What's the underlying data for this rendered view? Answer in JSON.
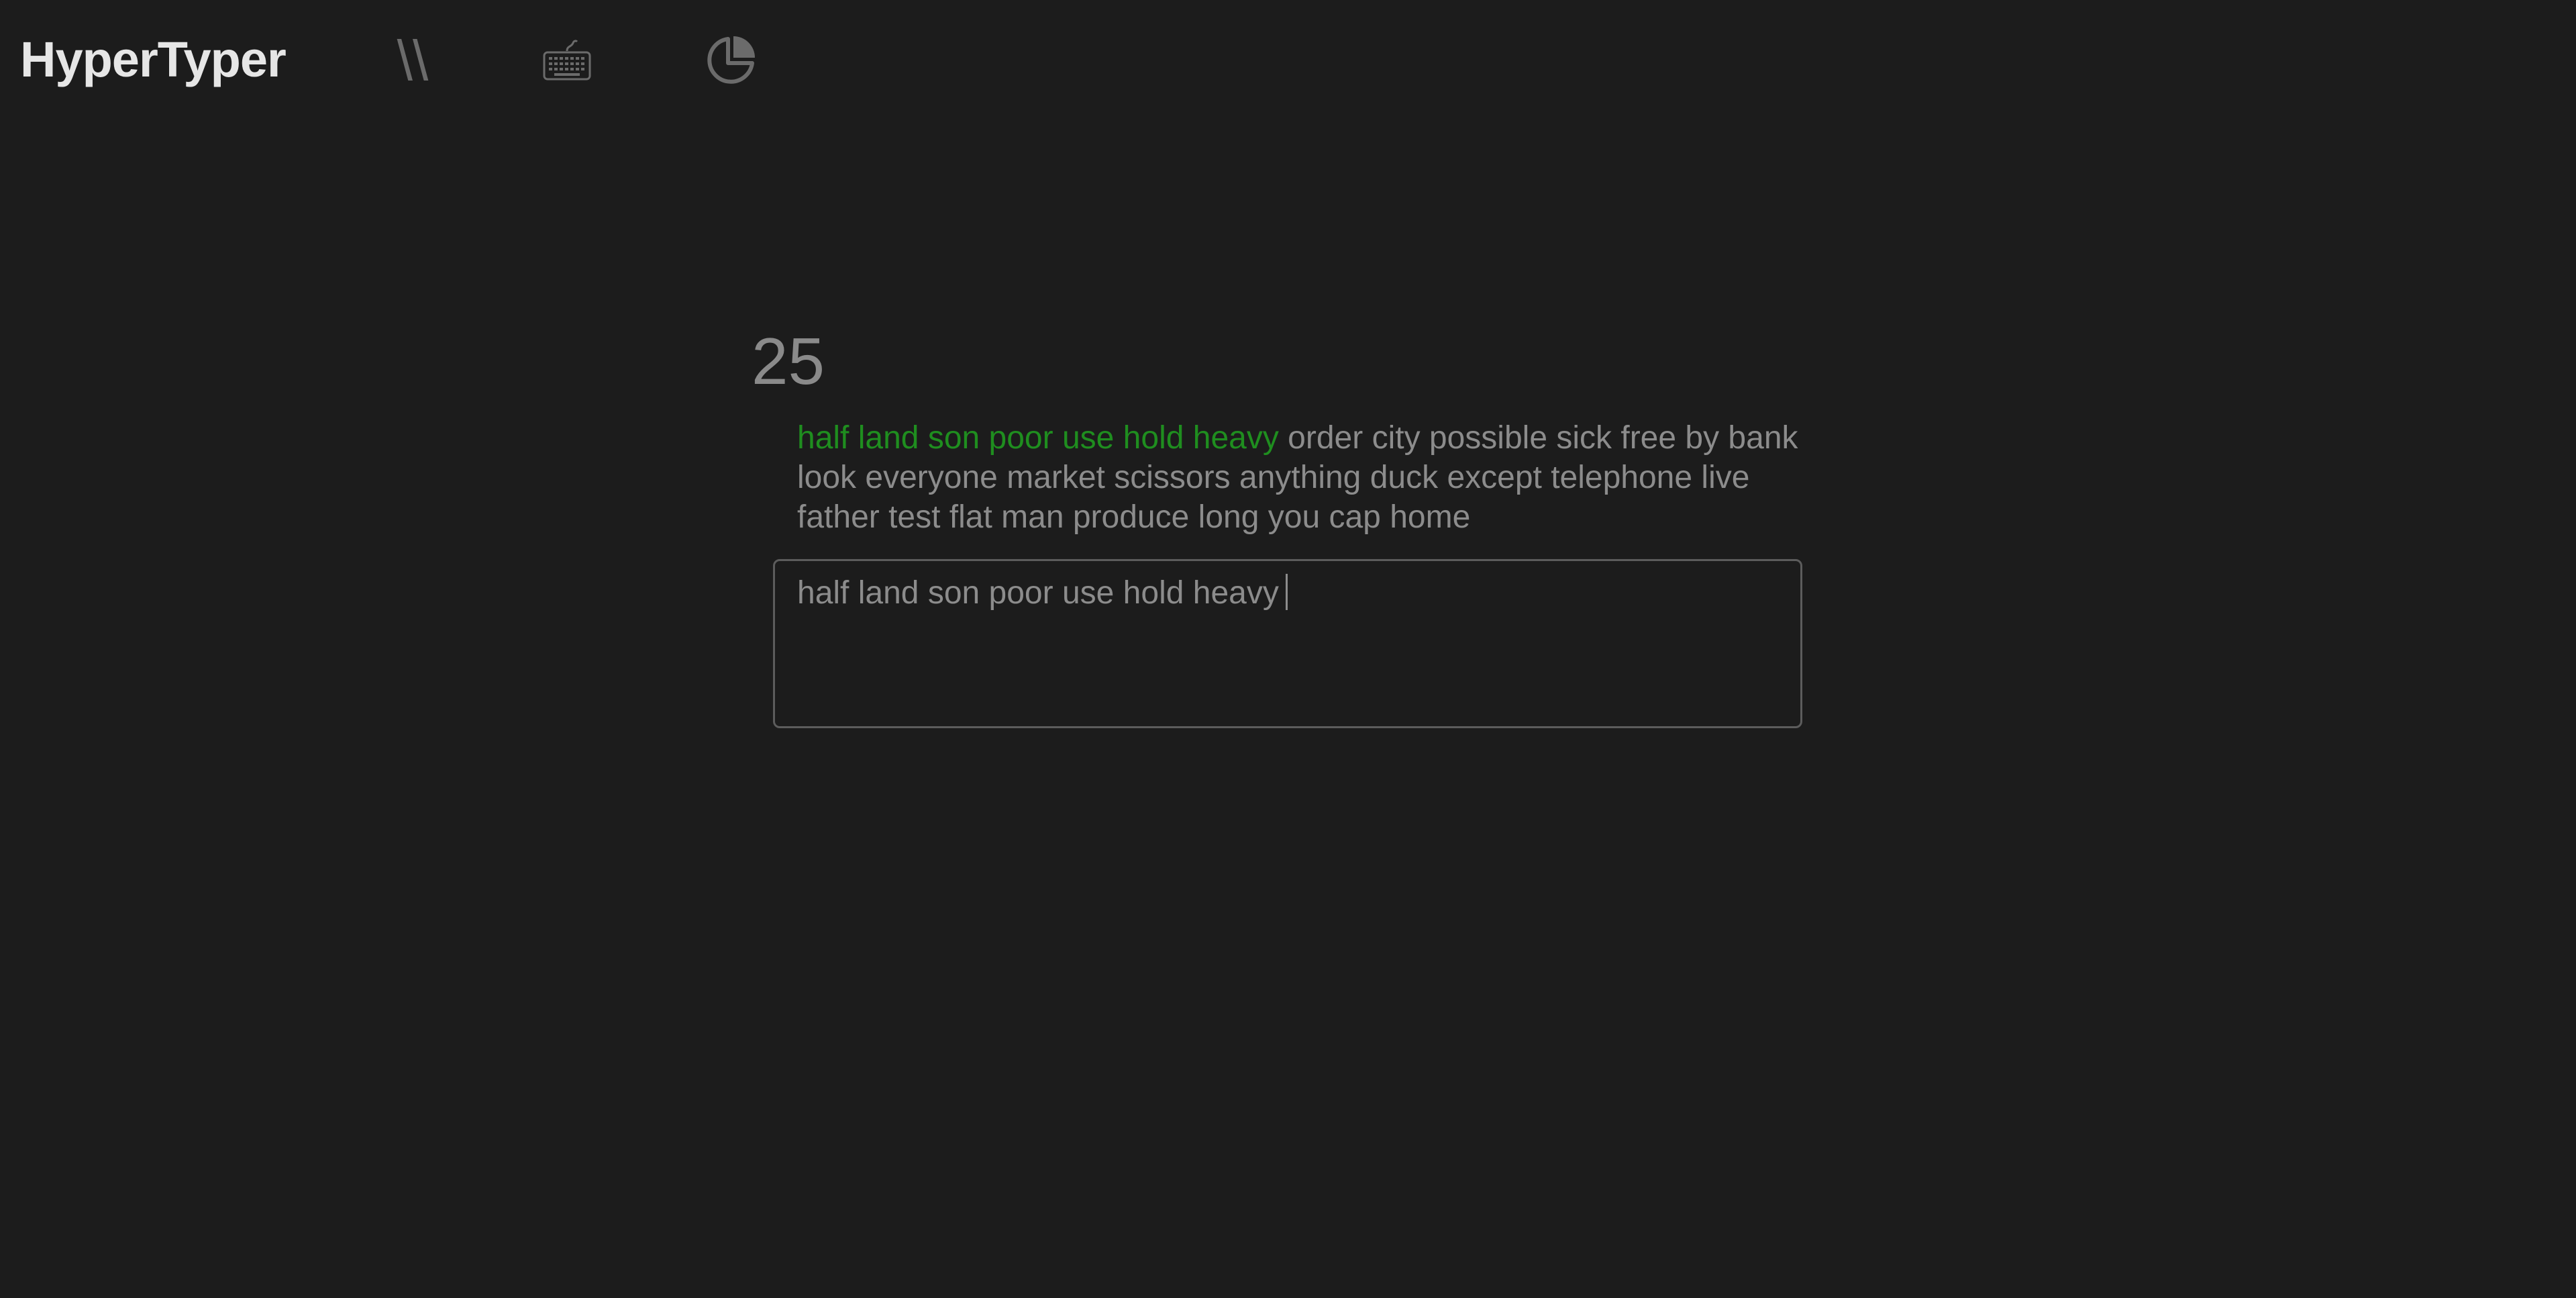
{
  "app": {
    "title": "HyperTyper"
  },
  "nav": {
    "items": [
      {
        "name": "test-mode",
        "icon": "double-slash-icon",
        "label": "\\\\"
      },
      {
        "name": "keyboard",
        "icon": "keyboard-icon"
      },
      {
        "name": "stats",
        "icon": "pie-chart-icon"
      }
    ]
  },
  "test": {
    "counter": "25",
    "typed_words": "half land son poor use hold heavy",
    "remaining_words": " order city possible sick free by bank look everyone market scissors anything duck except telephone live father test flat man produce long you cap home",
    "input_value": "half land son poor use hold heavy"
  },
  "colors": {
    "background": "#1c1c1c",
    "correct": "#1f8e1f",
    "text": "#8c8c8c",
    "icon": "#6b6b6b"
  }
}
